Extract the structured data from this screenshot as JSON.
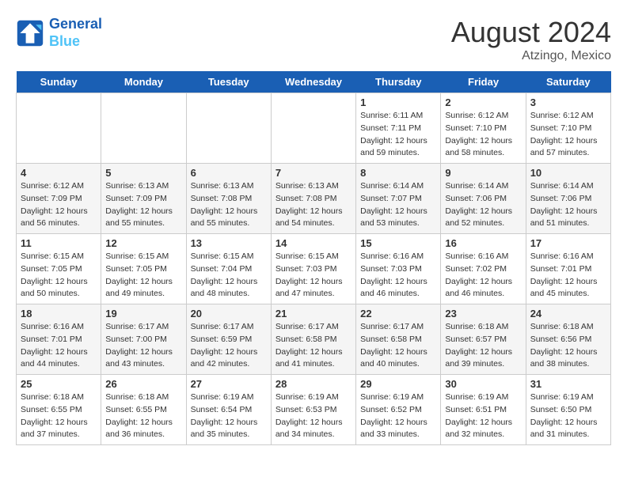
{
  "logo": {
    "line1": "General",
    "line2": "Blue"
  },
  "title": "August 2024",
  "subtitle": "Atzingo, Mexico",
  "days_of_week": [
    "Sunday",
    "Monday",
    "Tuesday",
    "Wednesday",
    "Thursday",
    "Friday",
    "Saturday"
  ],
  "weeks": [
    [
      {
        "day": "",
        "info": ""
      },
      {
        "day": "",
        "info": ""
      },
      {
        "day": "",
        "info": ""
      },
      {
        "day": "",
        "info": ""
      },
      {
        "day": "1",
        "info": "Sunrise: 6:11 AM\nSunset: 7:11 PM\nDaylight: 12 hours\nand 59 minutes."
      },
      {
        "day": "2",
        "info": "Sunrise: 6:12 AM\nSunset: 7:10 PM\nDaylight: 12 hours\nand 58 minutes."
      },
      {
        "day": "3",
        "info": "Sunrise: 6:12 AM\nSunset: 7:10 PM\nDaylight: 12 hours\nand 57 minutes."
      }
    ],
    [
      {
        "day": "4",
        "info": "Sunrise: 6:12 AM\nSunset: 7:09 PM\nDaylight: 12 hours\nand 56 minutes."
      },
      {
        "day": "5",
        "info": "Sunrise: 6:13 AM\nSunset: 7:09 PM\nDaylight: 12 hours\nand 55 minutes."
      },
      {
        "day": "6",
        "info": "Sunrise: 6:13 AM\nSunset: 7:08 PM\nDaylight: 12 hours\nand 55 minutes."
      },
      {
        "day": "7",
        "info": "Sunrise: 6:13 AM\nSunset: 7:08 PM\nDaylight: 12 hours\nand 54 minutes."
      },
      {
        "day": "8",
        "info": "Sunrise: 6:14 AM\nSunset: 7:07 PM\nDaylight: 12 hours\nand 53 minutes."
      },
      {
        "day": "9",
        "info": "Sunrise: 6:14 AM\nSunset: 7:06 PM\nDaylight: 12 hours\nand 52 minutes."
      },
      {
        "day": "10",
        "info": "Sunrise: 6:14 AM\nSunset: 7:06 PM\nDaylight: 12 hours\nand 51 minutes."
      }
    ],
    [
      {
        "day": "11",
        "info": "Sunrise: 6:15 AM\nSunset: 7:05 PM\nDaylight: 12 hours\nand 50 minutes."
      },
      {
        "day": "12",
        "info": "Sunrise: 6:15 AM\nSunset: 7:05 PM\nDaylight: 12 hours\nand 49 minutes."
      },
      {
        "day": "13",
        "info": "Sunrise: 6:15 AM\nSunset: 7:04 PM\nDaylight: 12 hours\nand 48 minutes."
      },
      {
        "day": "14",
        "info": "Sunrise: 6:15 AM\nSunset: 7:03 PM\nDaylight: 12 hours\nand 47 minutes."
      },
      {
        "day": "15",
        "info": "Sunrise: 6:16 AM\nSunset: 7:03 PM\nDaylight: 12 hours\nand 46 minutes."
      },
      {
        "day": "16",
        "info": "Sunrise: 6:16 AM\nSunset: 7:02 PM\nDaylight: 12 hours\nand 46 minutes."
      },
      {
        "day": "17",
        "info": "Sunrise: 6:16 AM\nSunset: 7:01 PM\nDaylight: 12 hours\nand 45 minutes."
      }
    ],
    [
      {
        "day": "18",
        "info": "Sunrise: 6:16 AM\nSunset: 7:01 PM\nDaylight: 12 hours\nand 44 minutes."
      },
      {
        "day": "19",
        "info": "Sunrise: 6:17 AM\nSunset: 7:00 PM\nDaylight: 12 hours\nand 43 minutes."
      },
      {
        "day": "20",
        "info": "Sunrise: 6:17 AM\nSunset: 6:59 PM\nDaylight: 12 hours\nand 42 minutes."
      },
      {
        "day": "21",
        "info": "Sunrise: 6:17 AM\nSunset: 6:58 PM\nDaylight: 12 hours\nand 41 minutes."
      },
      {
        "day": "22",
        "info": "Sunrise: 6:17 AM\nSunset: 6:58 PM\nDaylight: 12 hours\nand 40 minutes."
      },
      {
        "day": "23",
        "info": "Sunrise: 6:18 AM\nSunset: 6:57 PM\nDaylight: 12 hours\nand 39 minutes."
      },
      {
        "day": "24",
        "info": "Sunrise: 6:18 AM\nSunset: 6:56 PM\nDaylight: 12 hours\nand 38 minutes."
      }
    ],
    [
      {
        "day": "25",
        "info": "Sunrise: 6:18 AM\nSunset: 6:55 PM\nDaylight: 12 hours\nand 37 minutes."
      },
      {
        "day": "26",
        "info": "Sunrise: 6:18 AM\nSunset: 6:55 PM\nDaylight: 12 hours\nand 36 minutes."
      },
      {
        "day": "27",
        "info": "Sunrise: 6:19 AM\nSunset: 6:54 PM\nDaylight: 12 hours\nand 35 minutes."
      },
      {
        "day": "28",
        "info": "Sunrise: 6:19 AM\nSunset: 6:53 PM\nDaylight: 12 hours\nand 34 minutes."
      },
      {
        "day": "29",
        "info": "Sunrise: 6:19 AM\nSunset: 6:52 PM\nDaylight: 12 hours\nand 33 minutes."
      },
      {
        "day": "30",
        "info": "Sunrise: 6:19 AM\nSunset: 6:51 PM\nDaylight: 12 hours\nand 32 minutes."
      },
      {
        "day": "31",
        "info": "Sunrise: 6:19 AM\nSunset: 6:50 PM\nDaylight: 12 hours\nand 31 minutes."
      }
    ]
  ]
}
